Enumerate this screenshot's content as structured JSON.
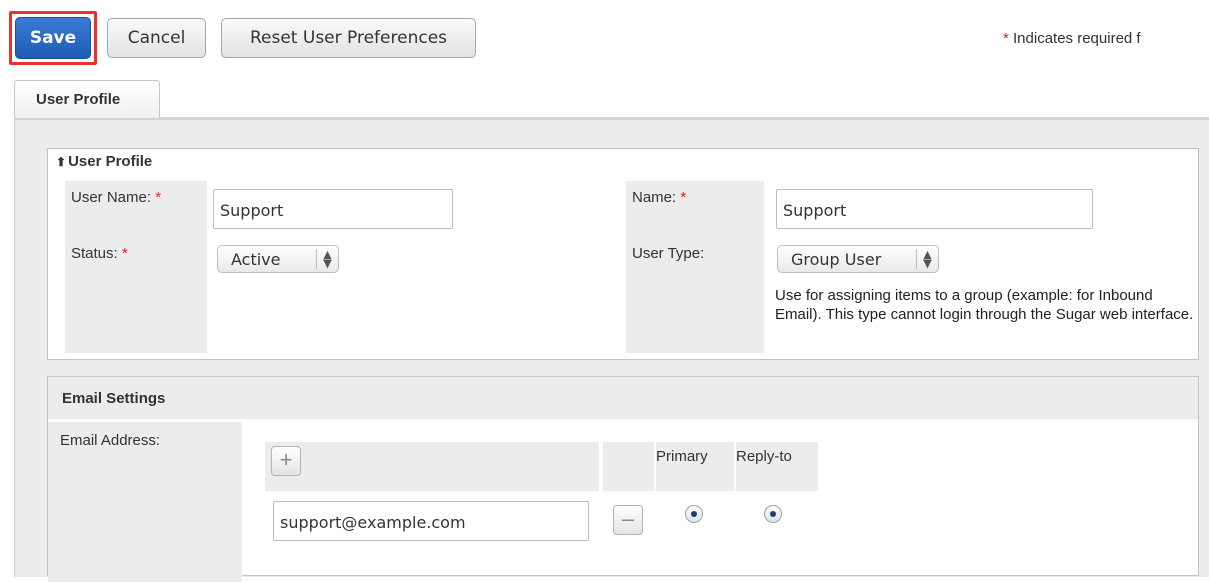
{
  "toolbar": {
    "save_label": "Save",
    "cancel_label": "Cancel",
    "reset_label": "Reset User Preferences",
    "required_star": "*",
    "required_note": "Indicates required f"
  },
  "tabs": [
    {
      "label": "User Profile"
    }
  ],
  "profile_panel": {
    "title": "User Profile",
    "collapse_icon": "double-chevron-up-icon",
    "user_name": {
      "label": "User Name:",
      "required": "*",
      "value": "Support"
    },
    "name": {
      "label": "Name:",
      "required": "*",
      "value": "Support"
    },
    "status": {
      "label": "Status:",
      "required": "*",
      "value": "Active"
    },
    "user_type": {
      "label": "User Type:",
      "value": "Group User",
      "help": "Use for assigning items to a group (example: for Inbound Email). This type cannot login through the Sugar web interface."
    }
  },
  "email_panel": {
    "title": "Email Settings",
    "email_address_label": "Email Address:",
    "add_icon": "+",
    "remove_icon": "–",
    "col_primary": "Primary",
    "col_reply_to": "Reply-to",
    "email_value": "support@example.com",
    "primary_checked": true,
    "reply_to_checked": true
  },
  "colors": {
    "save_button": "#2b6cc4",
    "highlight": "#e8322b",
    "required": "#e02020"
  }
}
